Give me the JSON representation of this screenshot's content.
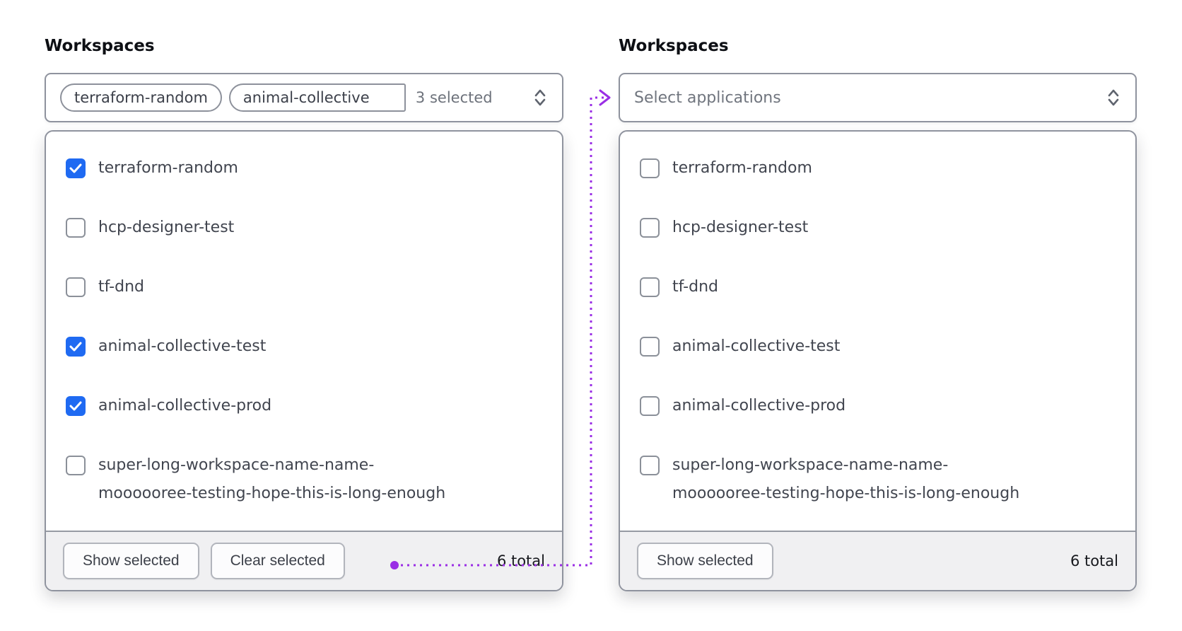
{
  "colors": {
    "accent-blue": "#1f6af2",
    "annotation-purple": "#9a2ee5",
    "border-gray": "#8f939e",
    "footer-bg": "#f0f0f2",
    "muted-text": "#6d727b"
  },
  "left_panel": {
    "label": "Workspaces",
    "trigger": {
      "tags": {
        "0": "terraform-random",
        "1": "animal-collective"
      },
      "summary": "3 selected",
      "icon": "chevron-up-down"
    },
    "items": [
      {
        "label": "terraform-random",
        "checked": true
      },
      {
        "label": "hcp-designer-test",
        "checked": false
      },
      {
        "label": "tf-dnd",
        "checked": false
      },
      {
        "label": "animal-collective-test",
        "checked": true
      },
      {
        "label": "animal-collective-prod",
        "checked": true
      },
      {
        "label": "super-long-workspace-name-name-\nmoooooree-testing-hope-this-is-long-enough",
        "checked": false
      }
    ],
    "footer": {
      "show_button": "Show selected",
      "clear_button": "Clear selected",
      "total": "6 total"
    }
  },
  "right_panel": {
    "label": "Workspaces",
    "trigger": {
      "placeholder": "Select applications",
      "icon": "chevron-up-down"
    },
    "items": [
      {
        "label": "terraform-random",
        "checked": false
      },
      {
        "label": "hcp-designer-test",
        "checked": false
      },
      {
        "label": "tf-dnd",
        "checked": false
      },
      {
        "label": "animal-collective-test",
        "checked": false
      },
      {
        "label": "animal-collective-prod",
        "checked": false
      },
      {
        "label": "super-long-workspace-name-name-\nmoooooree-testing-hope-this-is-long-enough",
        "checked": false
      }
    ],
    "footer": {
      "show_button": "Show selected",
      "total": "6 total"
    }
  },
  "annotation": {
    "type": "dotted-connector",
    "color": "#9a2ee5",
    "from": "clear-selected-button",
    "to": "right-select-trigger"
  }
}
